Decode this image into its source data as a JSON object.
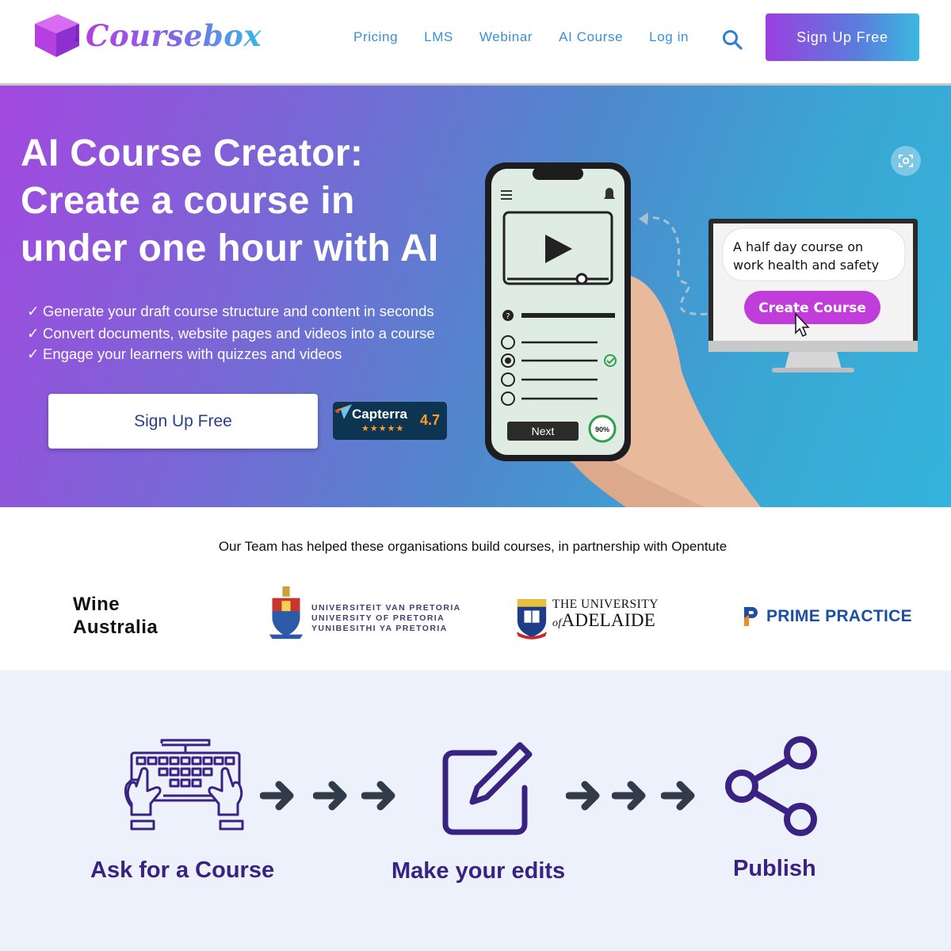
{
  "brand": {
    "name": "Coursebox"
  },
  "nav": {
    "items": [
      "Pricing",
      "LMS",
      "Webinar",
      "AI Course",
      "Log in"
    ],
    "signup_label": "Sign Up Free"
  },
  "hero": {
    "title_lines": [
      "AI Course Creator:",
      "Create a course in",
      "under one hour with AI"
    ],
    "bullets": [
      "Generate your draft course structure and content in seconds",
      "Convert documents, website pages and videos into a course",
      "Engage your learners with quizzes and videos"
    ],
    "bullet_mark": "✓",
    "signup_label": "Sign Up Free",
    "capterra": {
      "name": "Capterra",
      "score": "4.7",
      "stars": "★★★★★"
    },
    "illustration": {
      "prompt_text_1": "A half day course on",
      "prompt_text_2": "work health and safety",
      "create_button": "Create Course",
      "next_button": "Next",
      "progress": "90%"
    }
  },
  "partners": {
    "intro": "Our Team has helped these organisations build courses, in partnership with Opentute",
    "wine": [
      "Wine",
      "Australia"
    ],
    "pretoria": [
      "UNIVERSITEIT VAN PRETORIA",
      "UNIVERSITY OF PRETORIA",
      "YUNIBESITHI YA PRETORIA"
    ],
    "adelaide": {
      "line1": "THE UNIVERSITY",
      "of": "of",
      "line2": "ADELAIDE"
    },
    "prime": "PRIME PRACTICE"
  },
  "steps": [
    {
      "label": "Ask for a Course",
      "icon": "keyboard-hands-icon"
    },
    {
      "label": "Make your edits",
      "icon": "edit-icon"
    },
    {
      "label": "Publish",
      "icon": "share-icon"
    }
  ],
  "colors": {
    "accent_purple": "#a348e0",
    "accent_blue": "#34b4dc",
    "step_text": "#3a2283",
    "nav_link": "#3a8fd8"
  }
}
